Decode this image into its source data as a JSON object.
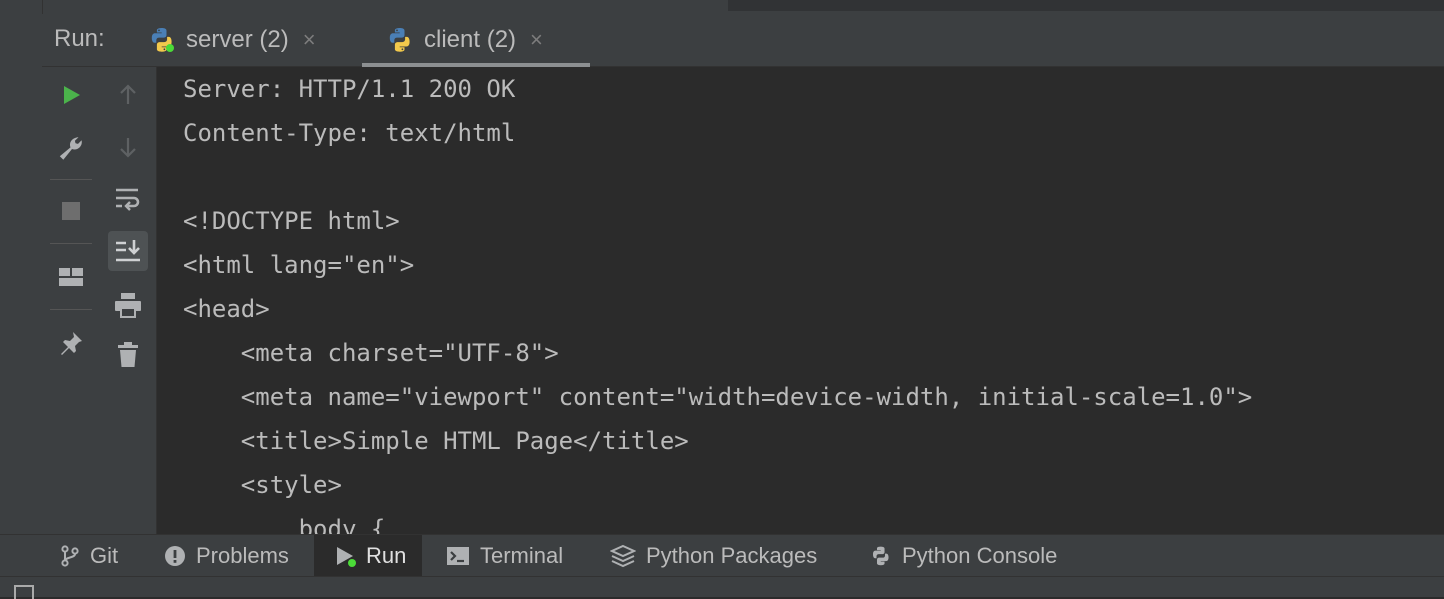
{
  "header": {
    "run_label": "Run:",
    "tabs": [
      {
        "label": "server (2)",
        "close": "×"
      },
      {
        "label": "client (2)",
        "close": "×"
      }
    ]
  },
  "console": {
    "lines": [
      "Server: HTTP/1.1 200 OK",
      "Content-Type: text/html",
      "",
      "<!DOCTYPE html>",
      "<html lang=\"en\">",
      "<head>",
      "    <meta charset=\"UTF-8\">",
      "    <meta name=\"viewport\" content=\"width=device-width, initial-scale=1.0\">",
      "    <title>Simple HTML Page</title>",
      "    <style>",
      "        body {"
    ]
  },
  "bottom_bar": {
    "items": [
      {
        "label": "Git",
        "icon": "git-branch-icon"
      },
      {
        "label": "Problems",
        "icon": "problems-icon"
      },
      {
        "label": "Run",
        "icon": "run-icon"
      },
      {
        "label": "Terminal",
        "icon": "terminal-icon"
      },
      {
        "label": "Python Packages",
        "icon": "packages-icon"
      },
      {
        "label": "Python Console",
        "icon": "python-console-icon"
      }
    ]
  },
  "colors": {
    "background": "#2b2b2b",
    "panel": "#3c3f41",
    "text": "#bbbbbb",
    "run_green": "#4bdb38"
  }
}
